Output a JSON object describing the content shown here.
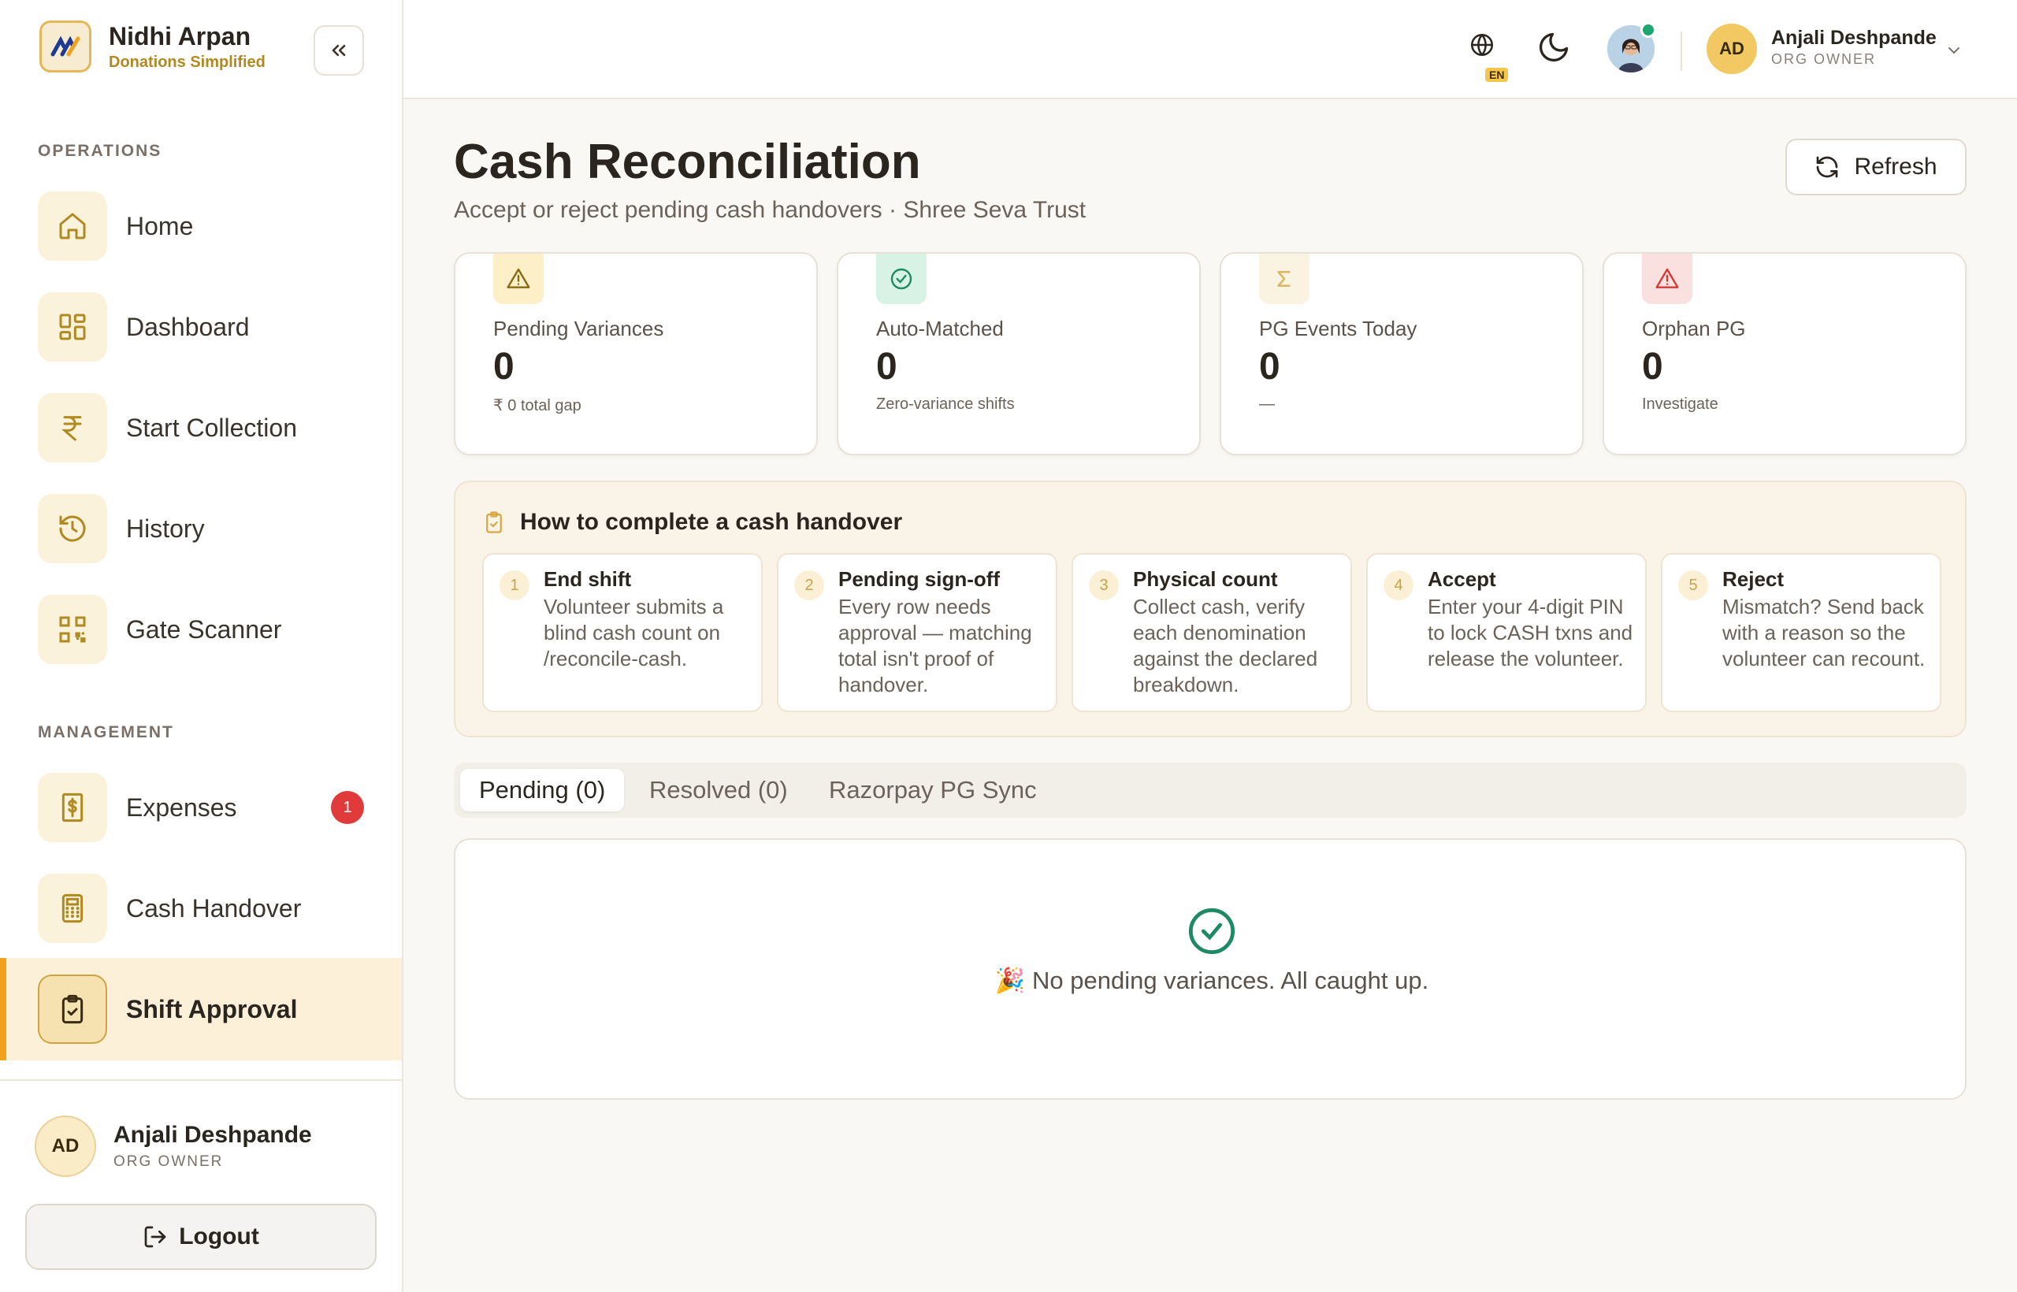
{
  "brand": {
    "name": "Nidhi Arpan",
    "tagline": "Donations Simplified"
  },
  "sidebar": {
    "sections": [
      {
        "label": "OPERATIONS"
      },
      {
        "label": "MANAGEMENT"
      }
    ],
    "items": [
      {
        "label": "Home",
        "icon": "home-icon"
      },
      {
        "label": "Dashboard",
        "icon": "dashboard-icon"
      },
      {
        "label": "Start Collection",
        "icon": "rupee-icon"
      },
      {
        "label": "History",
        "icon": "history-icon"
      },
      {
        "label": "Gate Scanner",
        "icon": "qr-icon"
      },
      {
        "label": "Expenses",
        "icon": "receipt-icon",
        "badge": "1"
      },
      {
        "label": "Cash Handover",
        "icon": "calculator-icon"
      },
      {
        "label": "Shift Approval",
        "icon": "clipboard-check-icon",
        "active": true
      }
    ],
    "footer": {
      "initials": "AD",
      "name": "Anjali Deshpande",
      "role": "ORG OWNER",
      "logout_label": "Logout"
    }
  },
  "topbar": {
    "language_badge": "EN",
    "user": {
      "initials": "AD",
      "name": "Anjali Deshpande",
      "role": "ORG OWNER"
    }
  },
  "page": {
    "title": "Cash Reconciliation",
    "subtitle": "Accept or reject pending cash handovers · Shree Seva Trust",
    "refresh_label": "Refresh"
  },
  "stats": [
    {
      "label": "Pending Variances",
      "value": "0",
      "note": "₹ 0 total gap",
      "icon": "warning-icon",
      "color": "#b7861f"
    },
    {
      "label": "Auto-Matched",
      "value": "0",
      "note": "Zero-variance shifts",
      "icon": "check-circle-icon",
      "color": "#1e8a63"
    },
    {
      "label": "PG Events Today",
      "value": "0",
      "note": "—",
      "icon": "sigma-icon",
      "color": "#d9b767"
    },
    {
      "label": "Orphan PG",
      "value": "0",
      "note": "Investigate",
      "icon": "alert-icon",
      "color": "#d23a3a"
    }
  ],
  "howto": {
    "title": "How to complete a cash handover",
    "steps": [
      {
        "num": "1",
        "title": "End shift",
        "text": "Volunteer submits a blind cash count on /reconcile-cash."
      },
      {
        "num": "2",
        "title": "Pending sign-off",
        "text": "Every row needs approval — matching total isn't proof of handover."
      },
      {
        "num": "3",
        "title": "Physical count",
        "text": "Collect cash, verify each denomination against the declared breakdown."
      },
      {
        "num": "4",
        "title": "Accept",
        "text": "Enter your 4-digit PIN to lock CASH txns and release the volunteer."
      },
      {
        "num": "5",
        "title": "Reject",
        "text": "Mismatch? Send back with a reason so the volunteer can recount."
      }
    ]
  },
  "tabs": [
    {
      "label": "Pending (0)",
      "active": true
    },
    {
      "label": "Resolved (0)"
    },
    {
      "label": "Razorpay PG Sync"
    }
  ],
  "empty_state": {
    "text": "🎉 No pending variances. All caught up."
  },
  "colors": {
    "accent": "#f0a21c",
    "active_bg": "#fdf0d8",
    "badge": "#e03a3a",
    "success": "#1e8a63"
  }
}
